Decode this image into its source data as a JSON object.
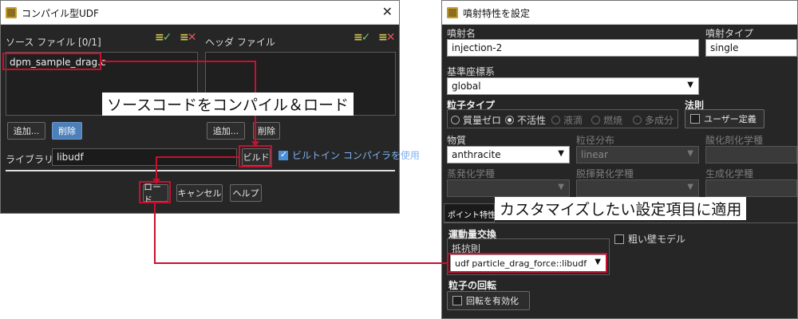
{
  "left_window": {
    "title": "コンパイル型UDF",
    "close_glyph": "✕",
    "source_header": "ソース ファイル [0/1]",
    "header_header": "ヘッダ ファイル",
    "source_files": [
      "dpm_sample_drag.c"
    ],
    "add_label": "追加...",
    "delete_label": "削除",
    "library_label": "ライブラリ名",
    "library_value": "libudf",
    "build_label": "ビルド",
    "builtin_compiler_label": "ビルトイン コンパイラを使用",
    "builtin_compiler_checked": true,
    "load_label": "ロード",
    "cancel_label": "キャンセル",
    "help_label": "ヘルプ",
    "callout": "ソースコードをコンパイル＆ロード"
  },
  "right_window": {
    "title": "噴射特性を設定",
    "injection_name_label": "噴射名",
    "injection_name_value": "injection-2",
    "injection_type_label": "噴射タイプ",
    "injection_type_value": "single",
    "coord_system_label": "基準座標系",
    "coord_system_value": "global",
    "particle_type_label": "粒子タイプ",
    "particle_types": [
      "質量ゼロ",
      "不活性",
      "液滴",
      "燃焼",
      "多成分"
    ],
    "particle_type_selected": "不活性",
    "law_label": "法則",
    "user_defined_label": "ユーザー定義",
    "material_label": "物質",
    "material_value": "anthracite",
    "diameter_dist_label": "粒径分布",
    "diameter_dist_value": "linear",
    "oxidizing_species_label": "酸化剤化学種",
    "evaporating_species_label": "蒸発化学種",
    "devolatilizing_species_label": "脱揮発化学種",
    "product_species_label": "生成化学種",
    "point_tab_label": "ポイント特性",
    "momentum_label": "運動量交換",
    "drag_law_label": "抵抗則",
    "drag_law_value": "udf particle_drag_force::libudf",
    "rough_wall_label": "粗い壁モデル",
    "rotation_label": "粒子の回転",
    "enable_rotation_label": "回転を有効化",
    "callout": "カスタマイズしたい設定項目に適用"
  },
  "colors": {
    "annotation_red": "#c8102e",
    "window_dark": "#262626",
    "selected_blue": "#4d7fb8"
  }
}
